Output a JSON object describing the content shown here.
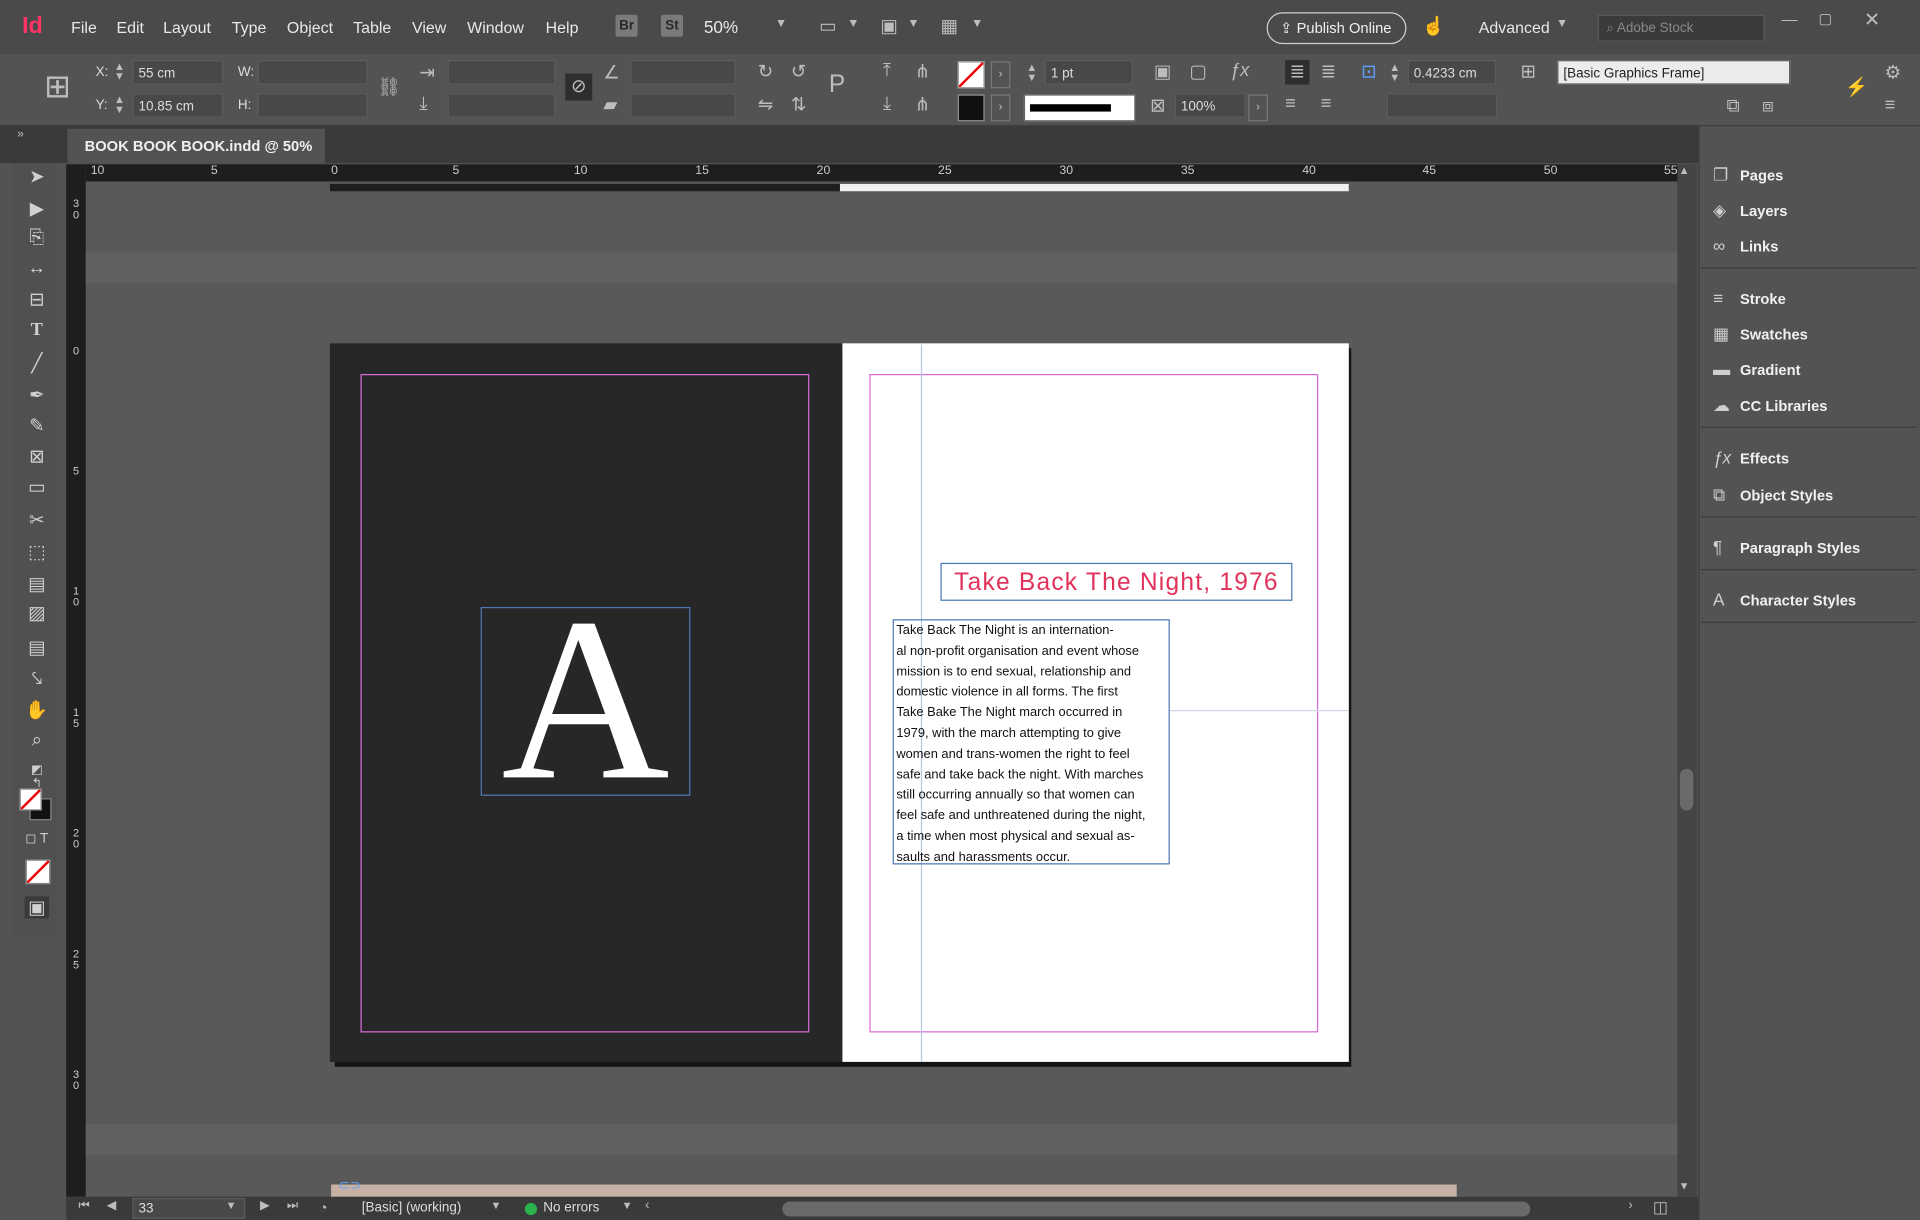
{
  "app": {
    "logo": "Id",
    "accent": "#ff3366"
  },
  "menubar": {
    "items": [
      "File",
      "Edit",
      "Layout",
      "Type",
      "Object",
      "Table",
      "View",
      "Window",
      "Help"
    ],
    "bridge": "Br",
    "stock_chip": "St",
    "zoom": "50%",
    "publish_label": "Publish Online",
    "workspace": "Advanced",
    "search_placeholder": "Adobe Stock"
  },
  "control": {
    "x_label": "X:",
    "x_value": "55 cm",
    "y_label": "Y:",
    "y_value": "10.85 cm",
    "w_label": "W:",
    "h_label": "H:",
    "stroke_weight": "1 pt",
    "opacity": "100%",
    "offset": "0.4233 cm",
    "object_style": "[Basic Graphics Frame]"
  },
  "document": {
    "tab_title": "BOOK BOOK BOOK.indd @ 50%",
    "close_glyph": "×",
    "h_ruler": [
      "10",
      "5",
      "0",
      "5",
      "10",
      "15",
      "20",
      "25",
      "30",
      "35",
      "40",
      "45",
      "50",
      "55"
    ],
    "v_ruler": [
      "3\n0",
      "0",
      "5",
      "1\n0",
      "1\n5",
      "2\n0",
      "2\n5",
      "3\n0"
    ]
  },
  "spread": {
    "left_page_color": "#272727",
    "big_letter": "A",
    "title": "Take Back The Night, 1976",
    "title_color": "#e0325a",
    "body_lines": [
      "Take Back The Night is an internation-",
      "al non-profit organisation and event whose",
      "mission is to end sexual, relationship and",
      "domestic violence in all forms. The first",
      "Take Bake The Night march occurred in",
      "1979, with the march attempting to give",
      "women and trans-women the right to feel",
      "safe and take back the night. With marches",
      "still occurring annually so that women can",
      "feel safe and unthreatened during the night,",
      "a time when most physical and sexual as-",
      "saults and harassments occur."
    ]
  },
  "panels": {
    "group1": [
      {
        "label": "Pages",
        "icon": "pages-icon"
      },
      {
        "label": "Layers",
        "icon": "layers-icon"
      },
      {
        "label": "Links",
        "icon": "links-icon"
      }
    ],
    "group2": [
      {
        "label": "Stroke",
        "icon": "stroke-icon"
      },
      {
        "label": "Swatches",
        "icon": "swatches-icon"
      },
      {
        "label": "Gradient",
        "icon": "gradient-icon"
      },
      {
        "label": "CC Libraries",
        "icon": "cc-libraries-icon"
      }
    ],
    "group3": [
      {
        "label": "Effects",
        "icon": "effects-icon"
      },
      {
        "label": "Object Styles",
        "icon": "object-styles-icon"
      }
    ],
    "group4": [
      {
        "label": "Paragraph Styles",
        "icon": "paragraph-styles-icon"
      }
    ],
    "group5": [
      {
        "label": "Character Styles",
        "icon": "character-styles-icon"
      }
    ]
  },
  "status": {
    "page": "33",
    "preflight_profile": "[Basic] (working)",
    "errors": "No errors",
    "errors_color": "#2bb24c"
  }
}
